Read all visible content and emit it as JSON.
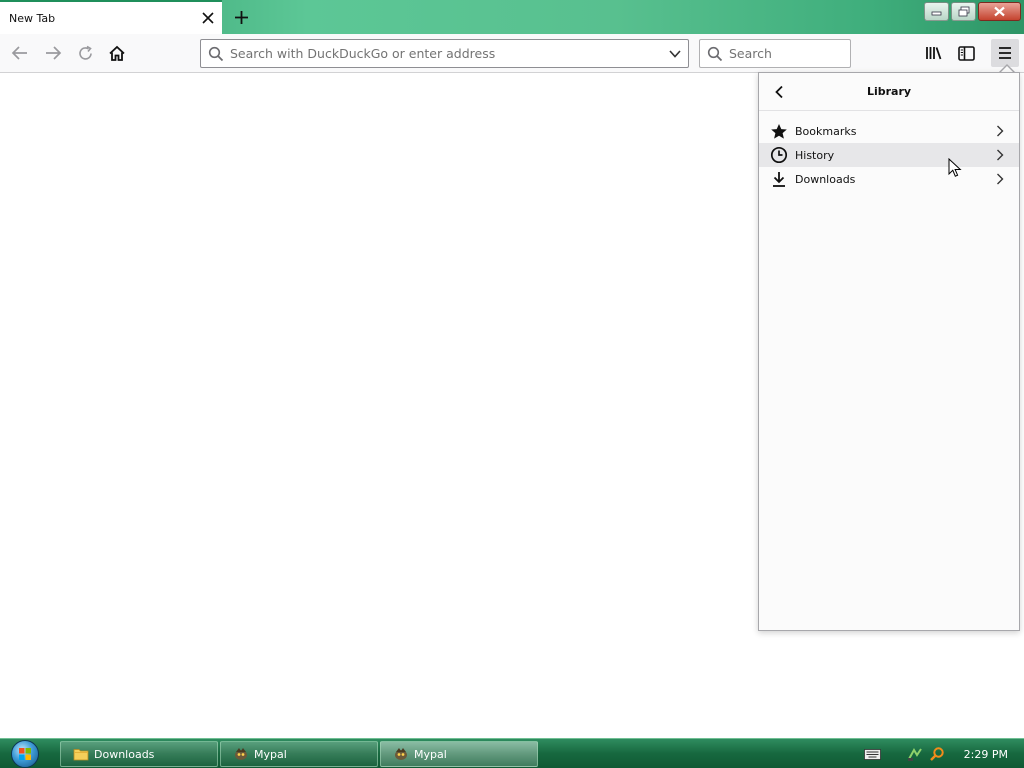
{
  "tab": {
    "title": "New Tab"
  },
  "toolbar": {
    "url_placeholder": "Search with DuckDuckGo or enter address",
    "search_placeholder": "Search"
  },
  "library_panel": {
    "title": "Library",
    "items": [
      {
        "label": "Bookmarks",
        "icon": "star-icon"
      },
      {
        "label": "History",
        "icon": "clock-icon"
      },
      {
        "label": "Downloads",
        "icon": "download-icon"
      }
    ]
  },
  "taskbar": {
    "items": [
      {
        "label": "Downloads",
        "icon": "folder-icon"
      },
      {
        "label": "Mypal",
        "icon": "mypal-icon"
      },
      {
        "label": "Mypal",
        "icon": "mypal-icon"
      }
    ],
    "clock": "2:29 PM"
  },
  "colors": {
    "titlebar_accent": "#58c08f",
    "taskbar_green": "#17683f",
    "panel_background": "#fbfbfb"
  }
}
